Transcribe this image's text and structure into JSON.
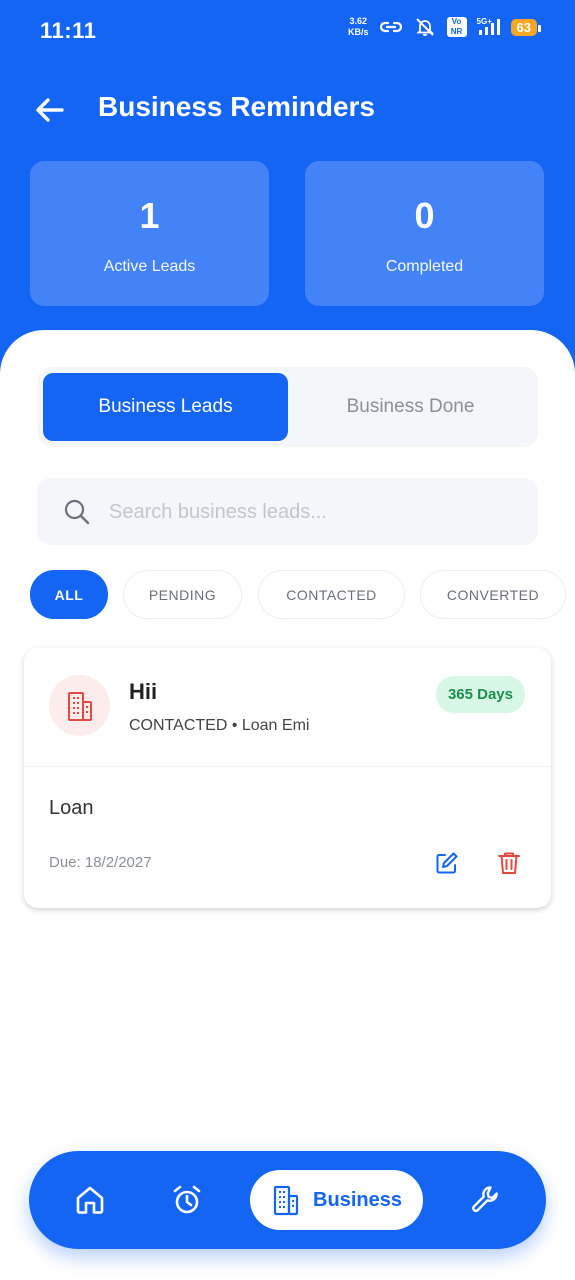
{
  "status_bar": {
    "time": "11:11",
    "net_speed_value": "3.62",
    "net_speed_unit": "KB/s",
    "volte": "Vo NR",
    "network": "5G+",
    "battery": "63"
  },
  "header": {
    "title": "Business Reminders",
    "back_icon": "arrow-left-icon"
  },
  "stats": [
    {
      "value": "1",
      "label": "Active Leads"
    },
    {
      "value": "0",
      "label": "Completed"
    }
  ],
  "tabs": [
    {
      "label": "Business Leads",
      "active": true
    },
    {
      "label": "Business Done",
      "active": false
    }
  ],
  "search": {
    "placeholder": "Search business leads...",
    "value": ""
  },
  "filters": [
    {
      "label": "ALL",
      "active": true
    },
    {
      "label": "PENDING",
      "active": false
    },
    {
      "label": "CONTACTED",
      "active": false
    },
    {
      "label": "CONVERTED",
      "active": false
    }
  ],
  "leads": [
    {
      "title": "Hii",
      "meta": "CONTACTED • Loan Emi",
      "badge": "365 Days",
      "description": "Loan",
      "due": "Due: 18/2/2027",
      "icon": "building-icon"
    }
  ],
  "bottom_nav": {
    "items": [
      {
        "icon": "home-icon"
      },
      {
        "icon": "alarm-clock-icon"
      },
      {
        "icon": "building-icon",
        "label": "Business",
        "active": true
      },
      {
        "icon": "wrench-icon"
      }
    ]
  },
  "colors": {
    "primary": "#1565f5",
    "danger": "#e5483f",
    "success_text": "#1a8f4c",
    "success_bg": "#d9f7e6"
  }
}
